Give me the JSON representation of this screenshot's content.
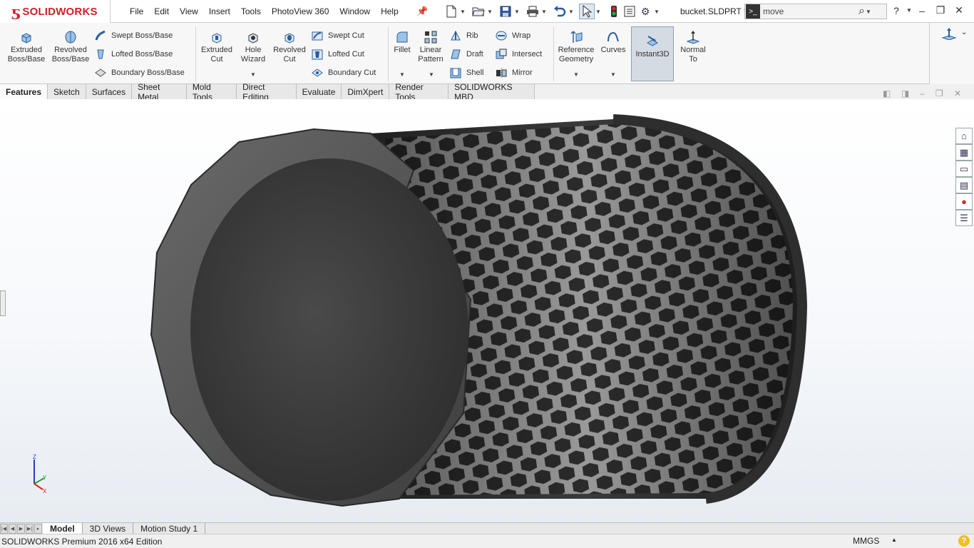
{
  "app": {
    "logo_text_solid": "SOLID",
    "logo_text_works": "WORKS",
    "doc_title": "bucket.SLDPRT *"
  },
  "menus": [
    "File",
    "Edit",
    "View",
    "Insert",
    "Tools",
    "PhotoView 360",
    "Window",
    "Help"
  ],
  "search": {
    "value": "move"
  },
  "features": {
    "extruded_boss": "Extruded Boss/Base",
    "revolved_boss": "Revolved Boss/Base",
    "swept_boss": "Swept Boss/Base",
    "lofted_boss": "Lofted Boss/Base",
    "boundary_boss": "Boundary Boss/Base",
    "extruded_cut": "Extruded Cut",
    "hole_wizard": "Hole Wizard",
    "revolved_cut": "Revolved Cut",
    "swept_cut": "Swept Cut",
    "lofted_cut": "Lofted Cut",
    "boundary_cut": "Boundary Cut",
    "fillet": "Fillet",
    "linear_pattern": "Linear Pattern",
    "rib": "Rib",
    "draft": "Draft",
    "shell": "Shell",
    "wrap": "Wrap",
    "intersect": "Intersect",
    "mirror": "Mirror",
    "reference_geometry": "Reference Geometry",
    "curves": "Curves",
    "instant3d": "Instant3D",
    "normal_to": "Normal To"
  },
  "tabs": [
    "Features",
    "Sketch",
    "Surfaces",
    "Sheet Metal",
    "Mold Tools",
    "Direct Editing",
    "Evaluate",
    "DimXpert",
    "Render Tools",
    "SOLIDWORKS MBD"
  ],
  "active_tab": "Features",
  "bottom_tabs": [
    "Model",
    "3D Views",
    "Motion Study 1"
  ],
  "status": {
    "edition": "SOLIDWORKS Premium 2016 x64 Edition",
    "units": "MMGS"
  },
  "triad": {
    "z": "Z",
    "y": "Y",
    "x": "X"
  },
  "colors": {
    "brand": "#d0202a",
    "model": "#4a4a4a"
  }
}
